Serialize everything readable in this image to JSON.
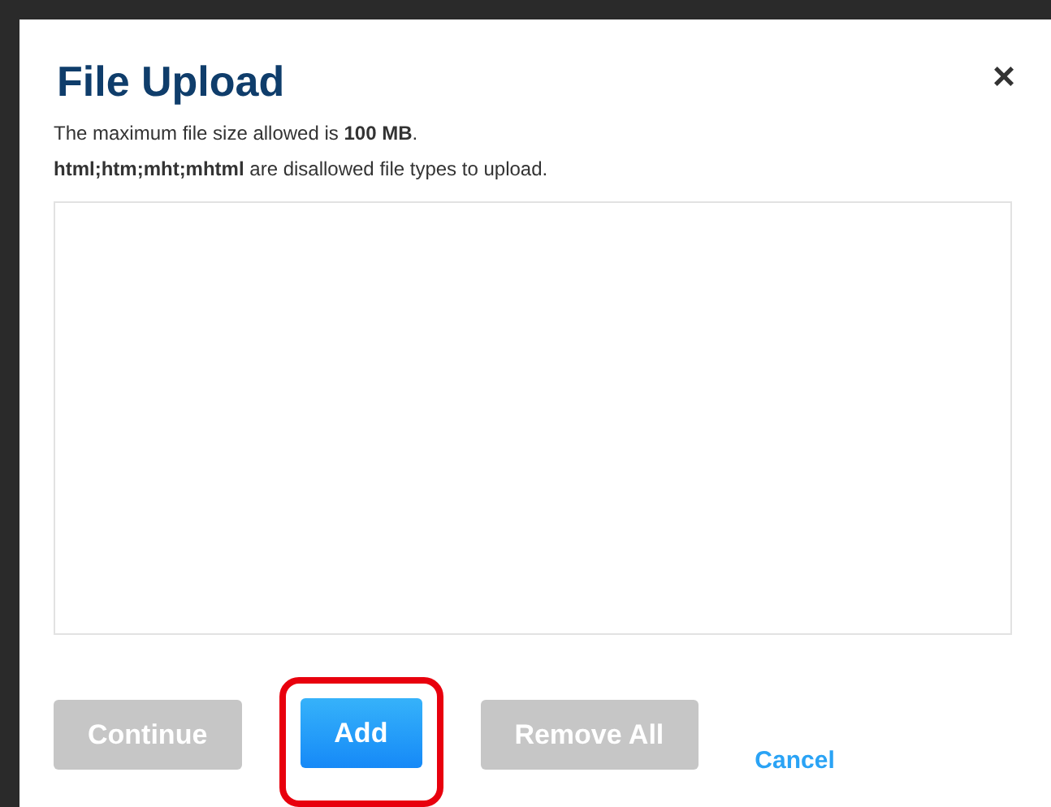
{
  "dialog": {
    "title": "File Upload",
    "close_label": "×",
    "notes": [
      "The maximum file size allowed is **100 MB**.",
      "**html;htm;mht;mhtml** are disallowed file types to upload."
    ],
    "buttons": [
      {
        "label": "Continue",
        "kind": "button",
        "disabled": true,
        "highlighted": false
      },
      {
        "label": "Add",
        "kind": "button",
        "disabled": false,
        "highlighted": true
      },
      {
        "label": "Remove All",
        "kind": "button",
        "disabled": true,
        "highlighted": false
      },
      {
        "label": "Cancel",
        "kind": "link",
        "disabled": false,
        "highlighted": false
      }
    ]
  }
}
